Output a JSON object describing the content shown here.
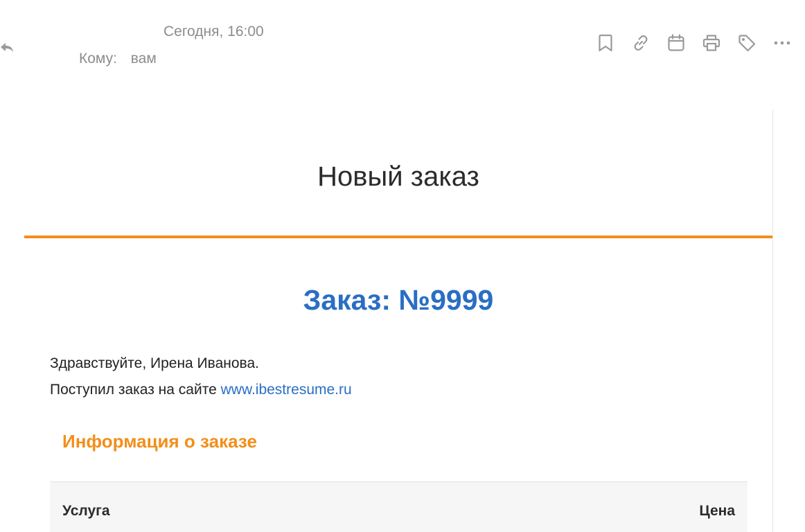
{
  "header": {
    "date": "Сегодня, 16:00",
    "to_label": "Кому:",
    "to_value": "вам",
    "toolbar_icons": [
      "bookmark-icon",
      "link-icon",
      "calendar-icon",
      "print-icon",
      "tag-icon",
      "more-icon"
    ]
  },
  "email": {
    "heading": "Новый заказ",
    "order_number": "Заказ: №9999",
    "greeting": "Здравствуйте, Ирена Иванова.",
    "order_text": "Поступил заказ на сайте",
    "site_link": "www.ibestresume.ru",
    "info_title": "Информация о заказе",
    "table": {
      "columns": [
        "Услуга",
        "Цена"
      ]
    }
  },
  "colors": {
    "accent_orange": "#f18f1b",
    "link_blue": "#2a6ec4",
    "muted_gray": "#8c8c8c"
  }
}
